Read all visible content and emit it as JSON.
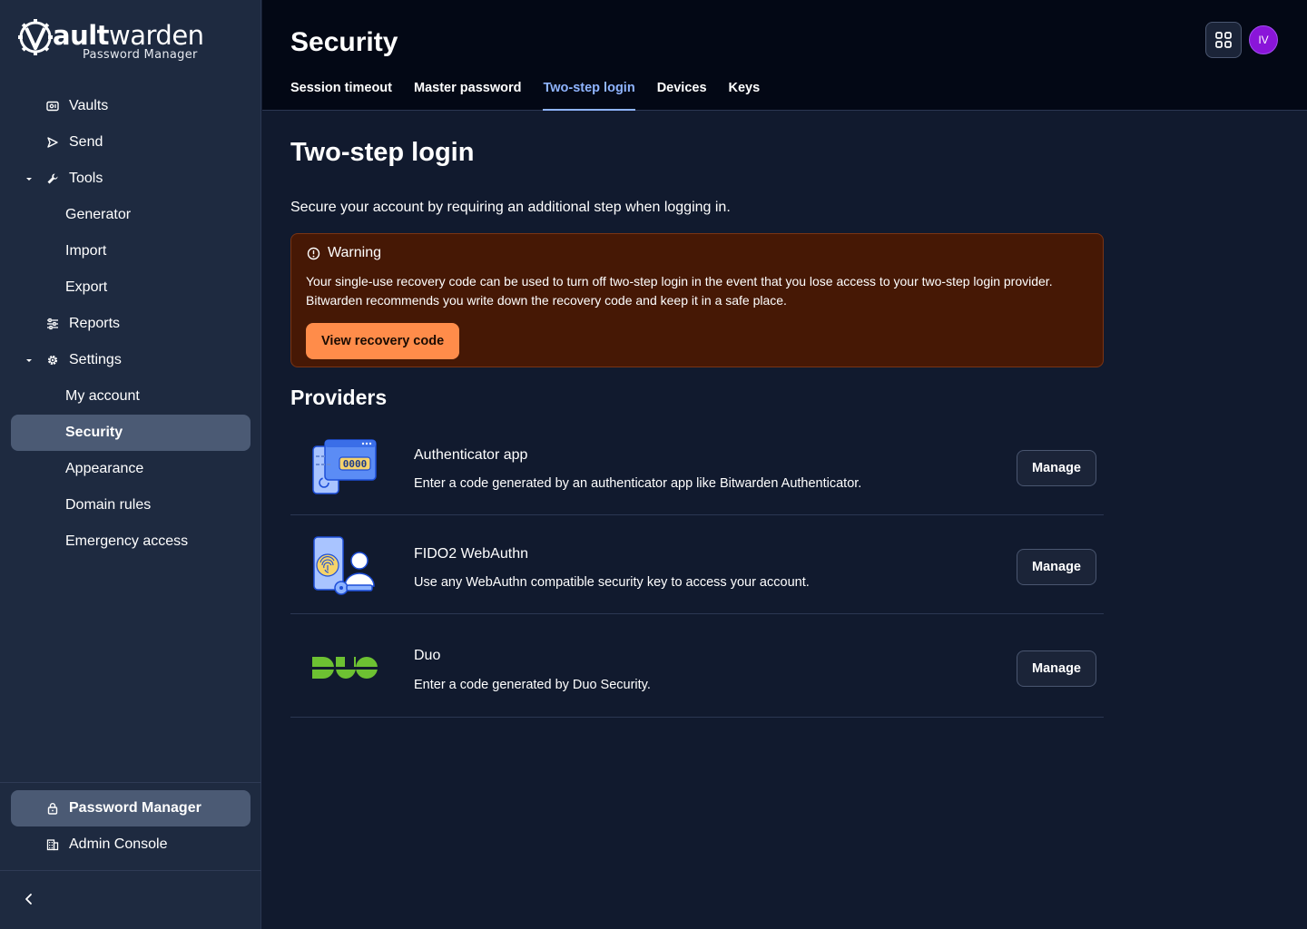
{
  "app": {
    "logo_word_bold": "V",
    "logo_word_rest_bold": "ault",
    "logo_word_rest_thin": "warden",
    "logo_subtitle": "Password Manager"
  },
  "sidebar": {
    "items": [
      {
        "label": "Vaults",
        "icon": "vault-icon"
      },
      {
        "label": "Send",
        "icon": "send-icon"
      },
      {
        "label": "Tools",
        "icon": "wrench-icon",
        "expanded": true
      },
      {
        "label": "Generator"
      },
      {
        "label": "Import"
      },
      {
        "label": "Export"
      },
      {
        "label": "Reports",
        "icon": "sliders-icon"
      },
      {
        "label": "Settings",
        "icon": "gear-icon",
        "expanded": true
      },
      {
        "label": "My account"
      },
      {
        "label": "Security",
        "active": true
      },
      {
        "label": "Appearance"
      },
      {
        "label": "Domain rules"
      },
      {
        "label": "Emergency access"
      }
    ],
    "products": [
      {
        "label": "Password Manager",
        "icon": "lock-icon",
        "active": true
      },
      {
        "label": "Admin Console",
        "icon": "building-icon"
      }
    ]
  },
  "header": {
    "title": "Security",
    "tabs": [
      "Session timeout",
      "Master password",
      "Two-step login",
      "Devices",
      "Keys"
    ],
    "active_tab": "Two-step login",
    "avatar_initials": "IV"
  },
  "main": {
    "title": "Two-step login",
    "description": "Secure your account by requiring an additional step when logging in.",
    "warning": {
      "title": "Warning",
      "body": "Your single-use recovery code can be used to turn off two-step login in the event that you lose access to your two-step login provider. Bitwarden recommends you write down the recovery code and keep it in a safe place.",
      "button": "View recovery code"
    },
    "providers_title": "Providers",
    "providers": [
      {
        "name": "Authenticator app",
        "description": "Enter a code generated by an authenticator app like Bitwarden Authenticator.",
        "button": "Manage",
        "code": "0000"
      },
      {
        "name": "FIDO2 WebAuthn",
        "description": "Use any WebAuthn compatible security key to access your account.",
        "button": "Manage"
      },
      {
        "name": "Duo",
        "description": "Enter a code generated by Duo Security.",
        "button": "Manage"
      }
    ]
  },
  "colors": {
    "sidebar_bg": "#1e2a40",
    "header_bg": "#030815",
    "main_bg": "#111a2e",
    "accent": "#8fb4ff",
    "warning_bg": "#461805",
    "warning_button": "#ff8c4a",
    "duo_green": "#6dc132",
    "avatar": "#8a15d9"
  }
}
